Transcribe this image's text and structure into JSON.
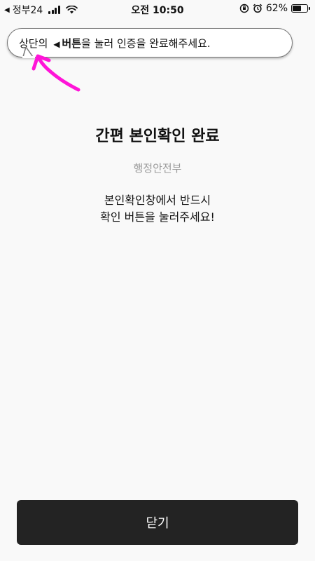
{
  "status_bar": {
    "back_glyph": "◀",
    "carrier": "정부24",
    "time": "오전 10:50",
    "battery_percent": "62%",
    "battery_level": 0.62,
    "icons": [
      "signal-icon",
      "wifi-icon",
      "orientation-lock-icon",
      "alarm-icon",
      "battery-icon"
    ]
  },
  "tooltip": {
    "prefix": "상단의",
    "pointer_glyph": "◀",
    "button_word": "버튼",
    "suffix": "을 눌러 인증을 완료해주세요.",
    "arrow_color": "#ff14d8"
  },
  "main": {
    "title": "간편 본인확인 완료",
    "subtitle": "행정안전부",
    "message_line1": "본인확인창에서 반드시",
    "message_line2": "확인 버튼을 눌러주세요!"
  },
  "footer": {
    "close_label": "닫기"
  },
  "colors": {
    "background": "#f9f9f9",
    "button_bg": "#232323",
    "subtitle": "#9a9a9a",
    "accent_arrow": "#ff14d8"
  }
}
